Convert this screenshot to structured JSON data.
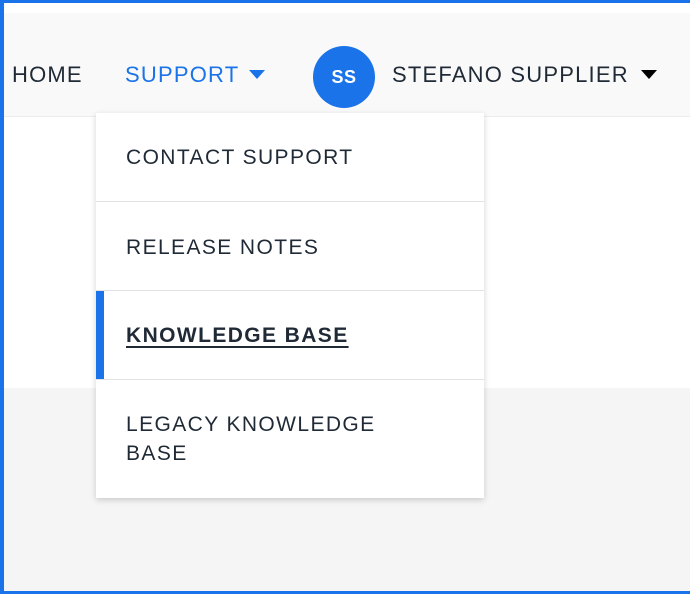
{
  "navbar": {
    "home_label": "HOME",
    "support_label": "SUPPORT",
    "avatar_initials": "SS",
    "user_label": "STEFANO SUPPLIER"
  },
  "support_menu": {
    "items": [
      {
        "label": "CONTACT SUPPORT",
        "active": false
      },
      {
        "label": "RELEASE NOTES",
        "active": false
      },
      {
        "label": "KNOWLEDGE BASE",
        "active": true
      },
      {
        "label": "LEGACY KNOWLEDGE BASE",
        "active": false
      }
    ]
  },
  "colors": {
    "accent": "#1a73e8",
    "text": "#1f2a36",
    "navbar_bg": "#f9f9f9"
  },
  "icons": {
    "support_caret": "caret-down-icon",
    "user_caret": "caret-down-icon"
  }
}
